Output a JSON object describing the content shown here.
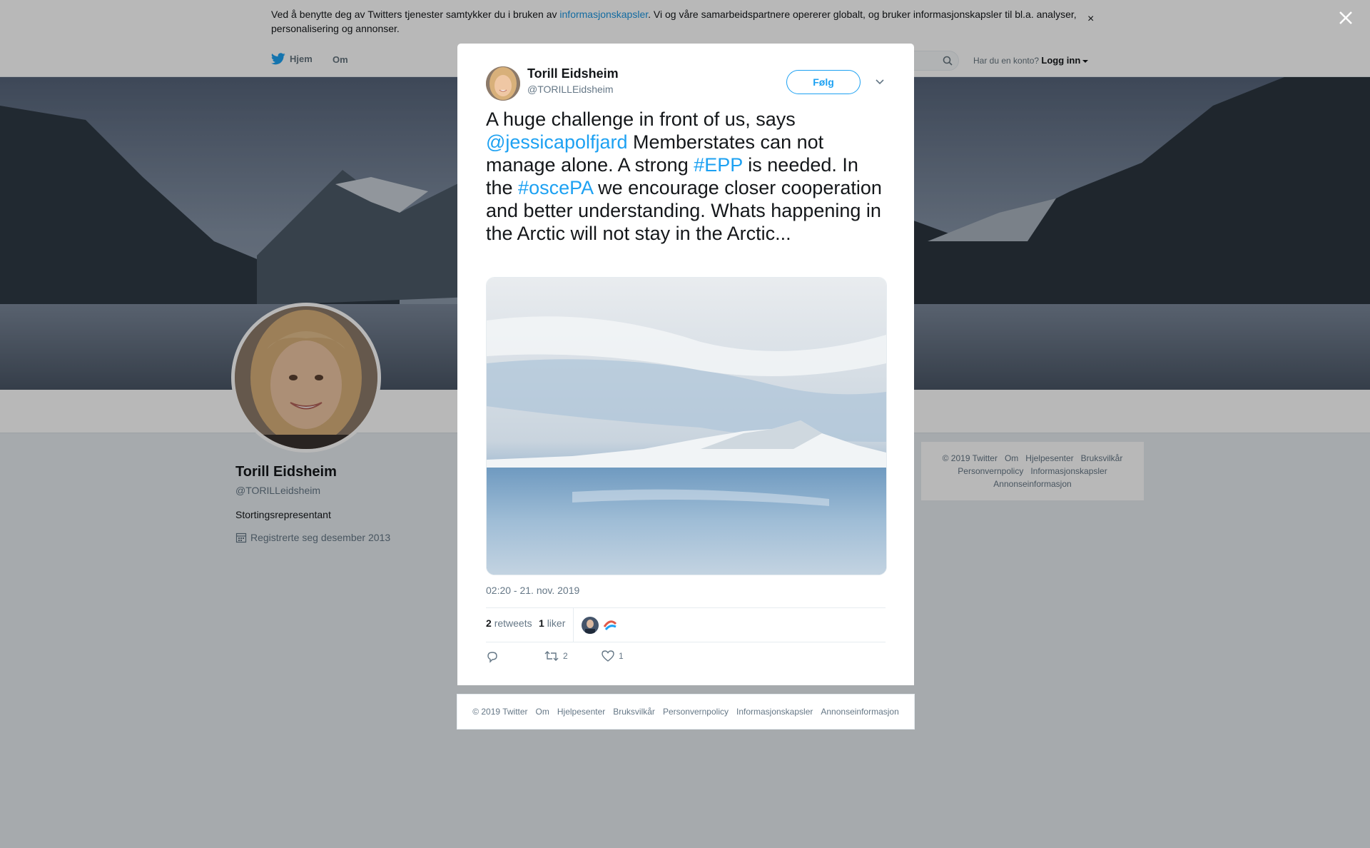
{
  "cookie_banner": {
    "text_before": "Ved å benytte deg av Twitters tjenester samtykker du i bruken av ",
    "link": "informasjonskapsler",
    "text_after": ". Vi og våre samarbeidspartnere opererer globalt, og bruker informasjonskapsler til bl.a. analyser, personalisering og annonser.",
    "close": "×"
  },
  "nav": {
    "home": "Hjem",
    "about": "Om",
    "account_prompt": "Har du en konto?",
    "login": "Logg inn"
  },
  "profile": {
    "name": "Torill Eidsheim",
    "handle": "@TORILLeidsheim",
    "bio": "Stortingsrepresentant",
    "joined": "Registrerte seg desember 2013"
  },
  "sidebar_footer": {
    "links": [
      "© 2019 Twitter",
      "Om",
      "Hjelpesenter",
      "Bruksvilkår",
      "Personvernpolicy",
      "Informasjonskapsler",
      "Annonseinformasjon"
    ]
  },
  "tweet": {
    "author_name": "Torill Eidsheim",
    "author_handle": "@TORILLEidsheim",
    "follow_label": "Følg",
    "text_1": "A huge challenge in front of us, says ",
    "mention": "@jessicapolfjard",
    "text_2": " Memberstates can not manage alone. A strong ",
    "hashtag_1": "#EPP",
    "text_3": " is needed. In the ",
    "hashtag_2": "#oscePA",
    "text_4": " we encourage closer cooperation and better understanding. Whats happening in the Arctic will not stay in the Arctic...",
    "timestamp": "02:20 - 21. nov. 2019",
    "retweets_count": "2",
    "retweets_label": "retweets",
    "likes_count": "1",
    "likes_label": "liker",
    "action_retweet_count": "2",
    "action_like_count": "1"
  },
  "modal_footer": {
    "links": [
      "© 2019 Twitter",
      "Om",
      "Hjelpesenter",
      "Bruksvilkår",
      "Personvernpolicy",
      "Informasjonskapsler",
      "Annonseinformasjon"
    ]
  },
  "colors": {
    "accent": "#1da1f2",
    "link": "#1b95e0",
    "page_bg": "#e6ecf0"
  }
}
